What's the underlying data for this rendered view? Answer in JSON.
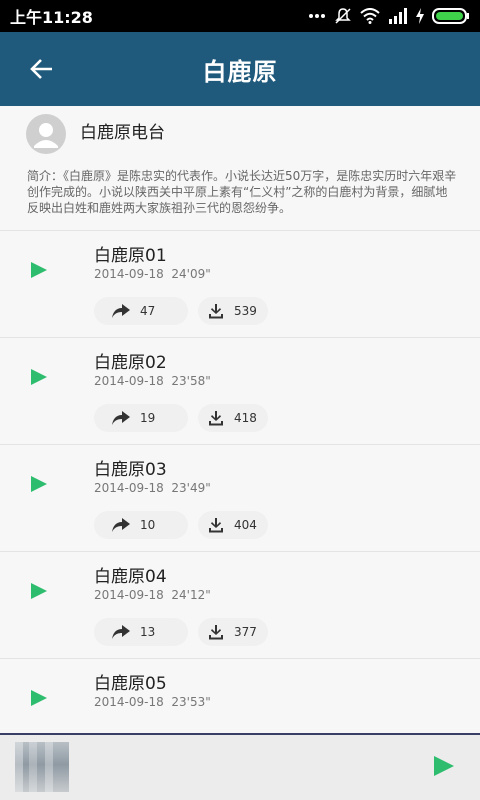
{
  "status_bar": {
    "time": "上午11:28",
    "icons": [
      "more-dots-icon",
      "mute-icon",
      "wifi-icon",
      "signal-icon",
      "charging-icon",
      "battery-icon"
    ]
  },
  "app_bar": {
    "title": "白鹿原",
    "back_icon": "arrow-left-icon",
    "color": "#1f5a7c"
  },
  "station": {
    "name": "白鹿原电台",
    "intro": "简介：《白鹿原》是陈忠实的代表作。小说长达近50万字，是陈忠实历时六年艰辛创作完成的。小说以陕西关中平原上素有“仁义村”之称的白鹿村为背景，细腻地反映出白姓和鹿姓两大家族祖孙三代的恩怨纷争。"
  },
  "episodes": [
    {
      "title": "白鹿原01",
      "date": "2014-09-18",
      "duration": "24'09\"",
      "shares": "47",
      "downloads": "539"
    },
    {
      "title": "白鹿原02",
      "date": "2014-09-18",
      "duration": "23'58\"",
      "shares": "19",
      "downloads": "418"
    },
    {
      "title": "白鹿原03",
      "date": "2014-09-18",
      "duration": "23'49\"",
      "shares": "10",
      "downloads": "404"
    },
    {
      "title": "白鹿原04",
      "date": "2014-09-18",
      "duration": "24'12\"",
      "shares": "13",
      "downloads": "377"
    },
    {
      "title": "白鹿原05",
      "date": "2014-09-18",
      "duration": "23'53\"",
      "shares": "",
      "downloads": ""
    }
  ],
  "player": {
    "play_icon": "play-icon"
  },
  "colors": {
    "accent_green": "#2ebd6e",
    "app_bar": "#1f5a7c"
  }
}
